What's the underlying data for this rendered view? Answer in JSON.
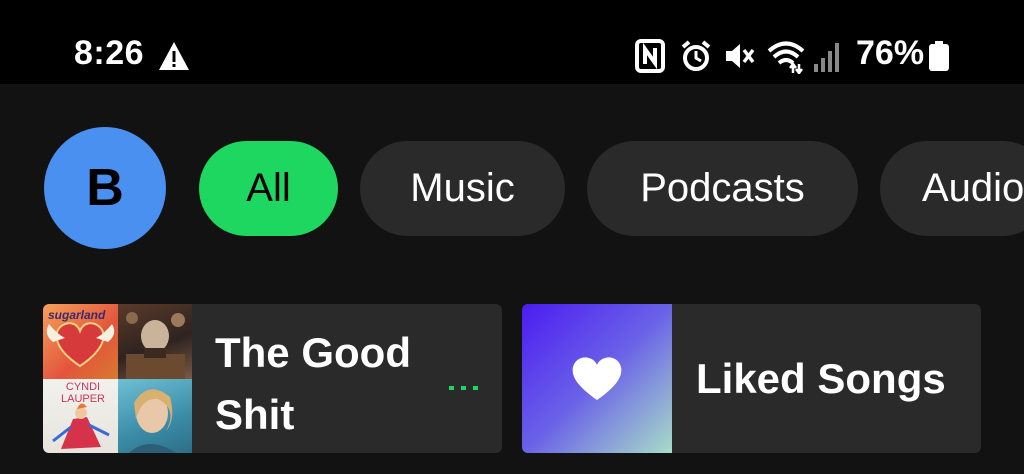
{
  "status_bar": {
    "time": "8:26",
    "battery_percent": "76%",
    "icons": [
      "warning-icon",
      "nfc-icon",
      "alarm-icon",
      "mute-icon",
      "wifi-icon",
      "signal-icon",
      "battery-icon"
    ]
  },
  "profile": {
    "avatar_letter": "B",
    "avatar_color": "#4a90f0"
  },
  "filters": {
    "chips": [
      {
        "label": "All",
        "active": true
      },
      {
        "label": "Music",
        "active": false
      },
      {
        "label": "Podcasts",
        "active": false
      },
      {
        "label": "Audio",
        "active": false
      }
    ],
    "accent_color": "#1ed760"
  },
  "shortcuts": [
    {
      "title": "The Good Shit",
      "indicator": "...",
      "indicator_color": "#1ed760",
      "art": {
        "type": "mosaic",
        "tiles": [
          {
            "text": "sugarland"
          },
          {
            "text": ""
          },
          {
            "text": "CYNDI LAUPER"
          },
          {
            "text": ""
          }
        ]
      }
    },
    {
      "title": "Liked Songs",
      "art": {
        "type": "icon",
        "icon": "heart-icon"
      }
    }
  ]
}
